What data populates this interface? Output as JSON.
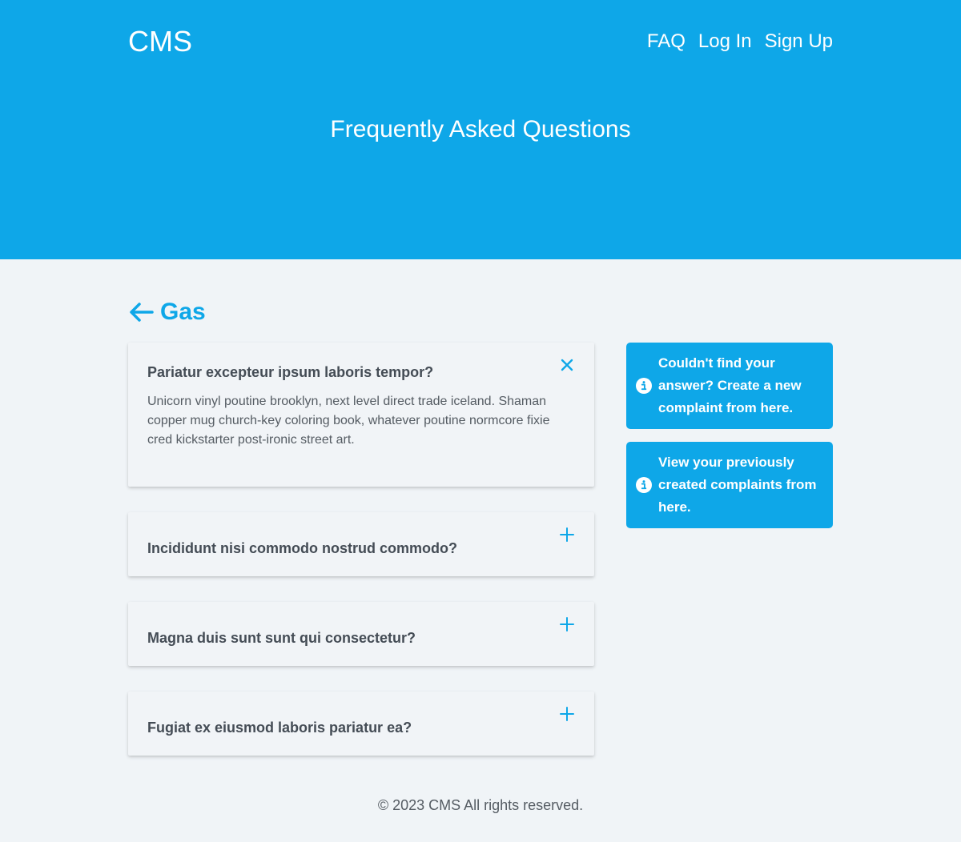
{
  "header": {
    "brand": "CMS",
    "nav": [
      {
        "label": "FAQ"
      },
      {
        "label": "Log In"
      },
      {
        "label": "Sign Up"
      }
    ],
    "title": "Frequently Asked Questions"
  },
  "category": {
    "name": "Gas",
    "back_icon": "arrow-left-icon"
  },
  "faqs": [
    {
      "question": "Pariatur excepteur ipsum laboris tempor?",
      "answer": "Unicorn vinyl poutine brooklyn, next level direct trade iceland. Shaman copper mug church-key coloring book, whatever poutine normcore fixie cred kickstarter post-ironic street art.",
      "expanded": true,
      "icon": "close-icon"
    },
    {
      "question": "Incididunt nisi commodo nostrud commodo?",
      "expanded": false,
      "icon": "plus-icon"
    },
    {
      "question": "Magna duis sunt sunt qui consectetur?",
      "expanded": false,
      "icon": "plus-icon"
    },
    {
      "question": "Fugiat ex eiusmod laboris pariatur ea?",
      "expanded": false,
      "icon": "plus-icon"
    }
  ],
  "sidebar": {
    "cards": [
      {
        "text": "Couldn't find your answer? Create a new complaint from here.",
        "icon": "info-icon"
      },
      {
        "text": "View your previously created complaints from here.",
        "icon": "info-icon"
      }
    ]
  },
  "footer": {
    "text": "© 2023 CMS All rights reserved."
  },
  "colors": {
    "accent": "#0ea7e8",
    "background": "#f0f4f7",
    "text": "#444c55"
  }
}
